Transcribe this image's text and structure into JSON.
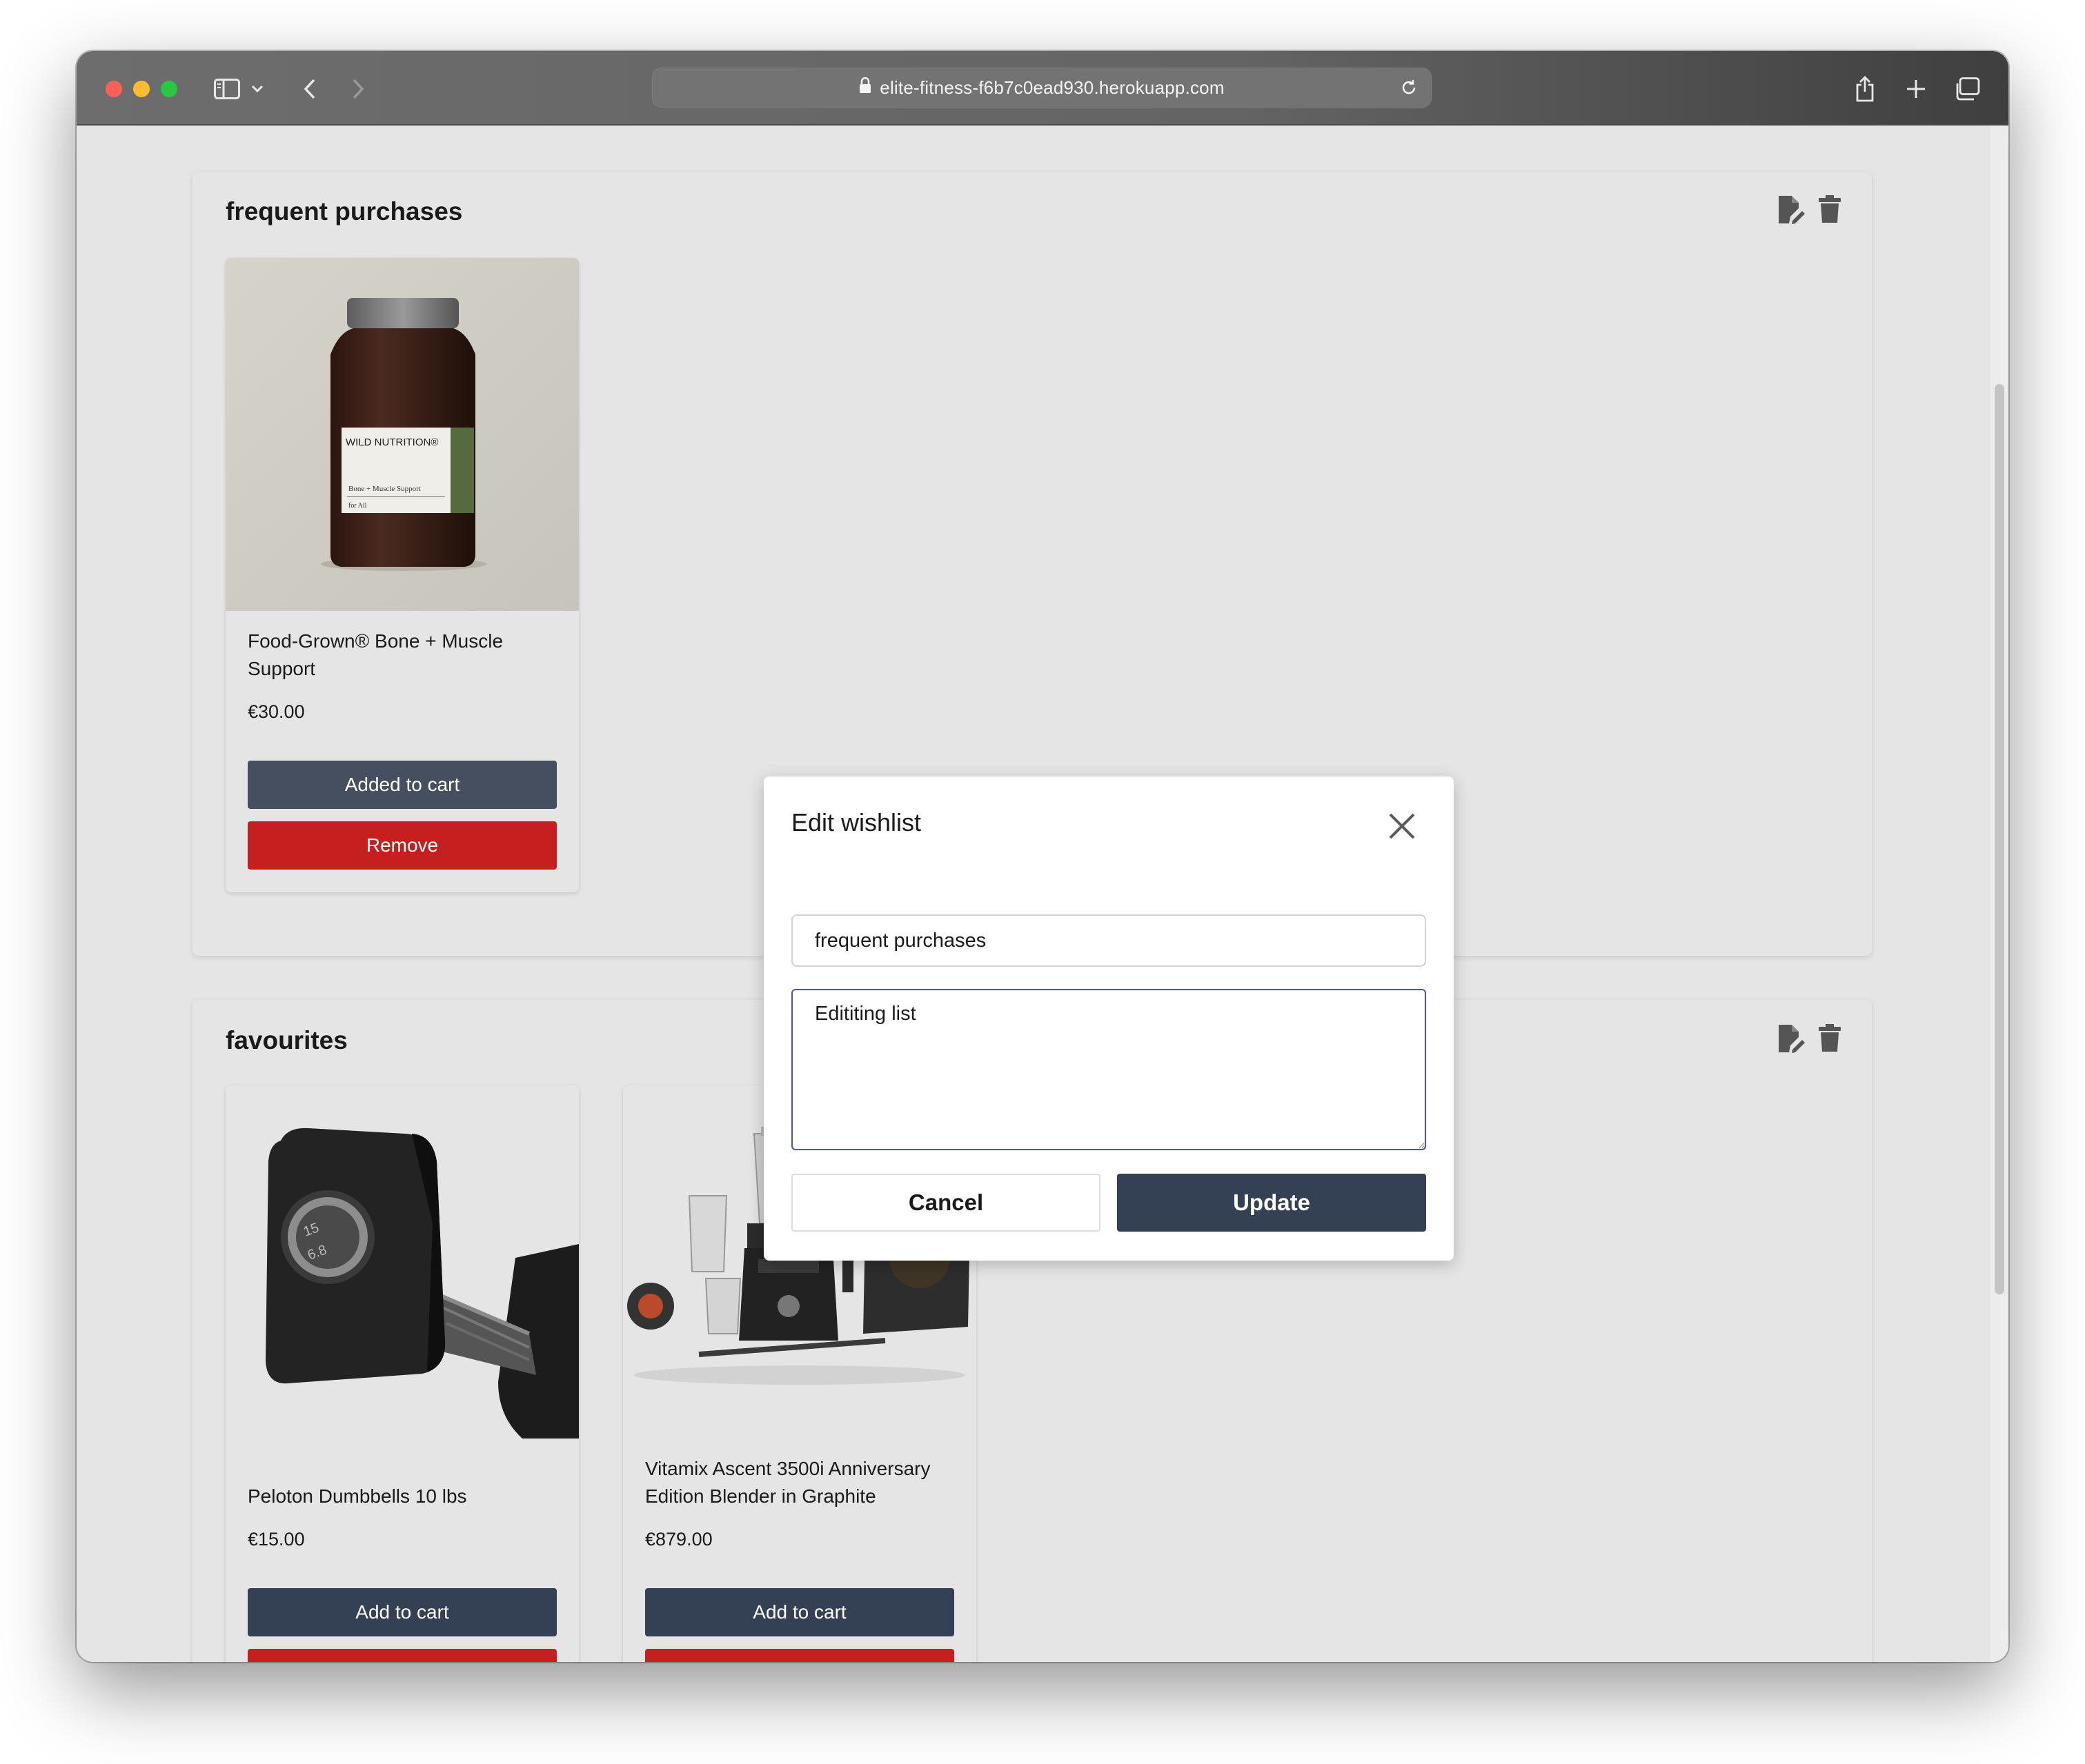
{
  "browser": {
    "url": "elite-fitness-f6b7c0ead930.herokuapp.com",
    "icons": [
      "sidebar-icon",
      "chevron-down-icon",
      "back-icon",
      "forward-icon",
      "lock-icon",
      "reload-icon",
      "share-icon",
      "new-tab-icon",
      "tabs-overview-icon"
    ]
  },
  "wishlists": [
    {
      "title": "frequent purchases",
      "items": [
        {
          "name": "Food-Grown® Bone + Muscle Support",
          "price": "€30.00",
          "cart_label": "Added to cart",
          "remove_label": "Remove",
          "image_label": "WILD NUTRITION®",
          "image_sublabel": "Bone + Muscle Support",
          "image_sublabel2": "for All"
        }
      ]
    },
    {
      "title": "favourites",
      "items": [
        {
          "name": "Peloton Dumbbells 10 lbs",
          "price": "€15.00",
          "cart_label": "Add to cart"
        },
        {
          "name": "Vitamix Ascent 3500i Anniversary Edition Blender in Graphite",
          "price": "€879.00",
          "cart_label": "Add to cart"
        }
      ]
    }
  ],
  "modal": {
    "title": "Edit wishlist",
    "name_value": "frequent purchases",
    "description_value": "Edititing list",
    "cancel_label": "Cancel",
    "update_label": "Update"
  },
  "colors": {
    "primary": "#344154",
    "danger": "#c71f1f",
    "focus_border": "#4b4fc4",
    "page_bg": "#e5e5e5"
  }
}
